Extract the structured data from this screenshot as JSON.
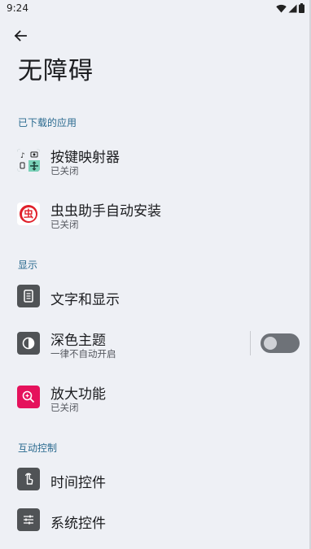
{
  "status": {
    "time": "9:24"
  },
  "page": {
    "title": "无障碍"
  },
  "sections": {
    "downloaded": "已下载的应用",
    "display": "显示",
    "interaction": "互动控制"
  },
  "items": {
    "key_mapper": {
      "title": "按键映射器",
      "subtitle": "已关闭",
      "icon": "key-mapper-app-icon"
    },
    "chongchong": {
      "title": "虫虫助手自动安装",
      "subtitle": "已关闭",
      "icon": "chongchong-app-icon",
      "icon_glyph": "虫"
    },
    "text_display": {
      "title": "文字和显示",
      "icon": "text-display-icon"
    },
    "dark_theme": {
      "title": "深色主题",
      "subtitle": "一律不自动开启",
      "icon": "contrast-icon",
      "enabled": false
    },
    "magnify": {
      "title": "放大功能",
      "subtitle": "已关闭",
      "icon": "zoom-in-icon"
    },
    "timing": {
      "title": "时间控件",
      "icon": "touch-hand-icon"
    },
    "system": {
      "title": "系统控件",
      "icon": "sliders-icon"
    }
  },
  "colors": {
    "background": "#eef0f5",
    "section_header": "#2a6a8f",
    "magnify_icon_bg": "#e5125c",
    "chongchong_red": "#e0202a",
    "gray_icon_bg": "#505356"
  }
}
